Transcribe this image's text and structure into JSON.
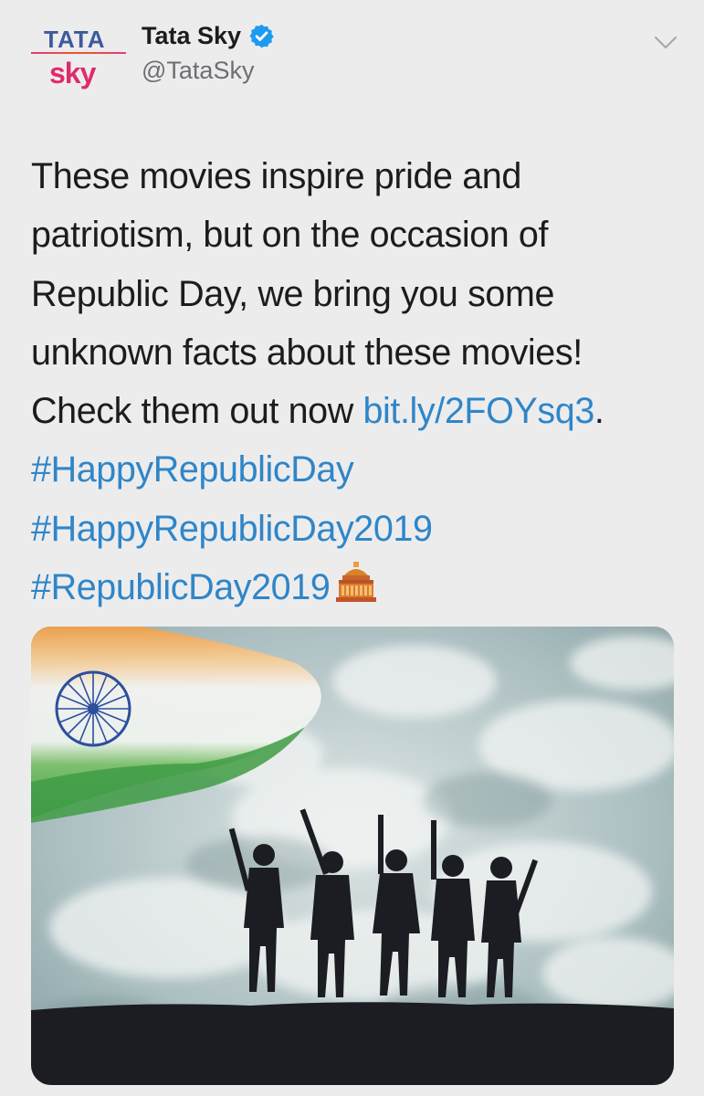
{
  "account": {
    "logo_top": "TATA",
    "logo_bottom": "sky",
    "display_name": "Tata Sky",
    "handle": "@TataSky",
    "verified_icon": "verified-badge-icon",
    "menu_icon": "chevron-down-icon"
  },
  "tweet": {
    "lines": [
      "These movies inspire pride and",
      "patriotism, but on the occasion of",
      "Republic Day, we bring you some",
      "unknown facts about these movies!"
    ],
    "check_text": "Check them out now ",
    "link": "bit.ly/2FOYsq3",
    "link_suffix": ".",
    "hashtags": [
      "#HappyRepublicDay",
      "#HappyRepublicDay2019",
      "#RepublicDay2019"
    ],
    "emoji": "classical-building-icon"
  },
  "media": {
    "image": "indian-flag-soldiers-silhouette-image"
  },
  "colors": {
    "background": "#edeced",
    "link": "#2f86c8",
    "verified": "#1d9bf0",
    "text": "#1c1c1e",
    "secondary": "#6e6e73"
  }
}
